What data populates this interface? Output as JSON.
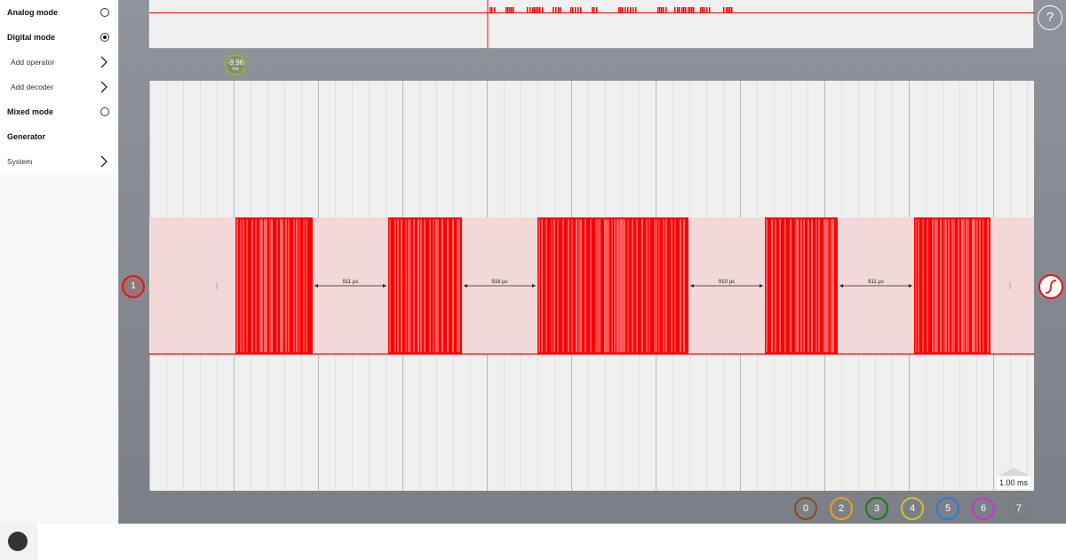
{
  "sidebar": {
    "items": [
      {
        "label": "Analog mode",
        "control": "radio-off"
      },
      {
        "label": "Digital mode",
        "control": "radio-on"
      },
      {
        "label": "Add operator",
        "control": "chevron"
      },
      {
        "label": "Add decoder",
        "control": "chevron"
      },
      {
        "label": "Mixed mode",
        "control": "radio-off"
      },
      {
        "label": "Generator",
        "control": "none"
      },
      {
        "label": "System",
        "control": "chevron"
      }
    ]
  },
  "cursor": {
    "value": "-9.96",
    "unit": "ms"
  },
  "channel_marker": {
    "label": "1"
  },
  "help": {
    "label": "?"
  },
  "timebase": {
    "label": "1.00 ms"
  },
  "measurements": [
    "911 µs",
    "916 µs",
    "910 µs",
    "911 µs"
  ],
  "channels": [
    {
      "label": "0",
      "color": "#8c4a1e"
    },
    {
      "label": "2",
      "color": "#e8a020"
    },
    {
      "label": "3",
      "color": "#1a7a1a"
    },
    {
      "label": "4",
      "color": "#d0c030"
    },
    {
      "label": "5",
      "color": "#2a7ad8"
    },
    {
      "label": "6",
      "color": "#d030d0"
    },
    {
      "label": "7",
      "color": "#7a7a7a"
    }
  ],
  "colors": {
    "signal": "#ff0000",
    "band": "#f2d8d8",
    "cursor": "#9ab32c"
  }
}
